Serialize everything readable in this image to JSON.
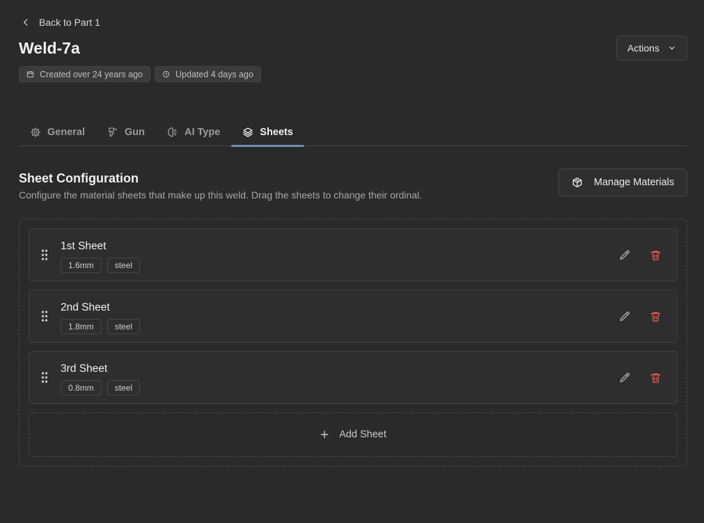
{
  "nav": {
    "back_label": "Back to Part 1"
  },
  "header": {
    "title": "Weld-7a",
    "created": "Created over 24 years ago",
    "updated": "Updated 4 days ago",
    "actions_label": "Actions"
  },
  "tabs": [
    {
      "label": "General",
      "icon": "gear-icon"
    },
    {
      "label": "Gun",
      "icon": "weld-gun-icon"
    },
    {
      "label": "AI Type",
      "icon": "ai-brain-icon"
    },
    {
      "label": "Sheets",
      "icon": "layers-icon",
      "active": true
    }
  ],
  "section": {
    "title": "Sheet Configuration",
    "description": "Configure the material sheets that make up this weld. Drag the sheets to change their ordinal.",
    "manage_label": "Manage Materials"
  },
  "sheets": [
    {
      "name": "1st Sheet",
      "thickness": "1.6mm",
      "material": "steel"
    },
    {
      "name": "2nd Sheet",
      "thickness": "1.8mm",
      "material": "steel"
    },
    {
      "name": "3rd Sheet",
      "thickness": "0.8mm",
      "material": "steel"
    }
  ],
  "add_sheet_label": "Add Sheet",
  "colors": {
    "background": "#2a2a2a",
    "accent": "#6f8fb3",
    "danger": "#e05252"
  }
}
